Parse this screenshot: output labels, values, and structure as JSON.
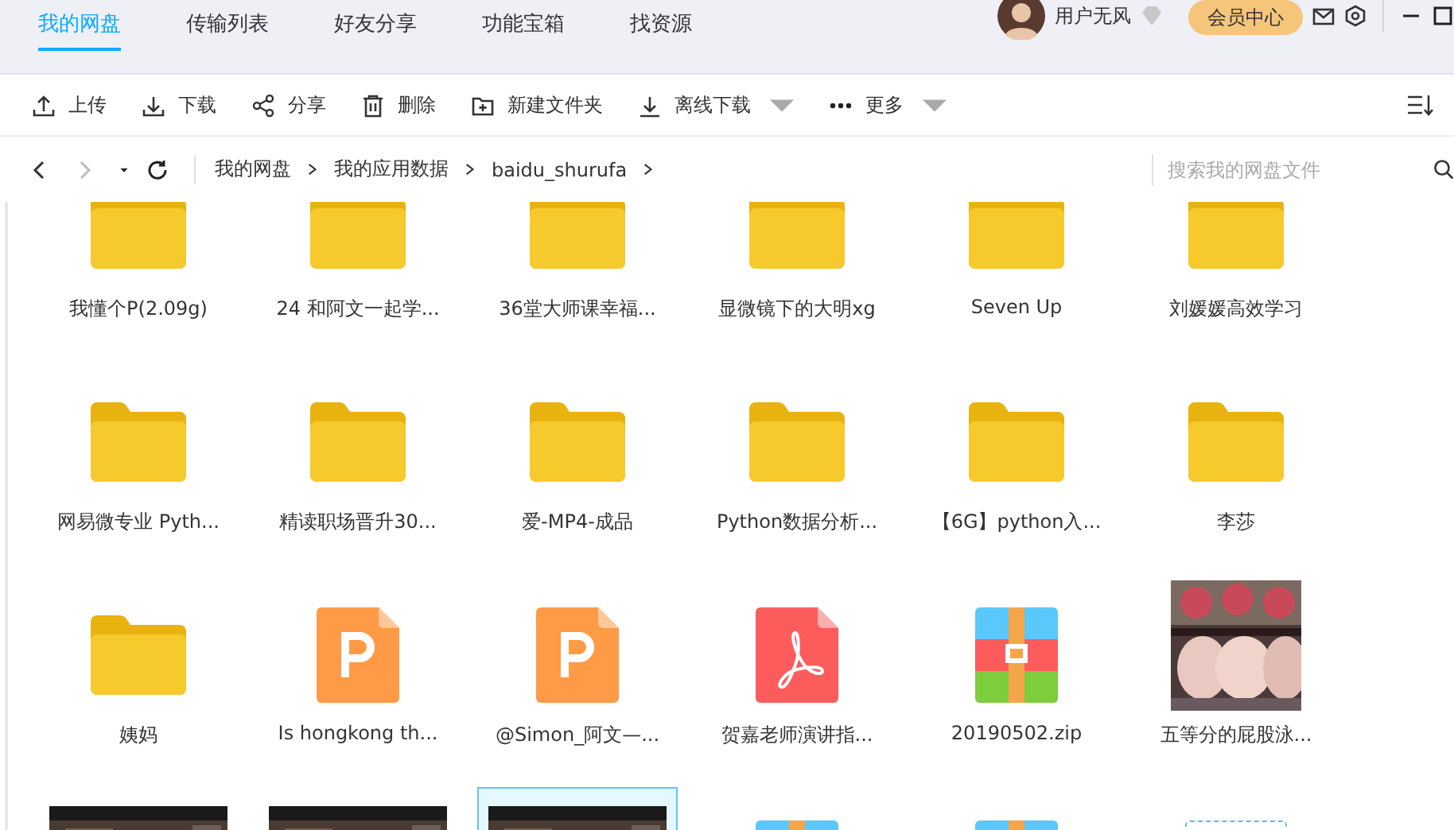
{
  "tabs": [
    {
      "label": "我的网盘",
      "selected": true
    },
    {
      "label": "传输列表",
      "selected": false
    },
    {
      "label": "好友分享",
      "selected": false
    },
    {
      "label": "功能宝箱",
      "selected": false
    },
    {
      "label": "找资源",
      "selected": false
    }
  ],
  "user": {
    "name": "用户无风",
    "vip_button": "会员中心"
  },
  "toolbar": [
    {
      "kind": "upload",
      "label": "上传",
      "dropdown": false
    },
    {
      "kind": "download",
      "label": "下载",
      "dropdown": false
    },
    {
      "kind": "share",
      "label": "分享",
      "dropdown": false
    },
    {
      "kind": "delete",
      "label": "删除",
      "dropdown": false
    },
    {
      "kind": "newfolder",
      "label": "新建文件夹",
      "dropdown": false
    },
    {
      "kind": "offline",
      "label": "离线下载",
      "dropdown": true
    },
    {
      "kind": "more",
      "label": "更多",
      "dropdown": true
    }
  ],
  "breadcrumb": [
    "我的网盘",
    "我的应用数据",
    "baidu_shurufa"
  ],
  "search": {
    "placeholder": "搜索我的网盘文件"
  },
  "files": [
    {
      "kind": "folder",
      "name": "我懂个P(2.09g)",
      "selected": false
    },
    {
      "kind": "folder",
      "name": "24 和阿文一起学...",
      "selected": false
    },
    {
      "kind": "folder",
      "name": "36堂大师课幸福...",
      "selected": false
    },
    {
      "kind": "folder",
      "name": "显微镜下的大明xg",
      "selected": false
    },
    {
      "kind": "folder",
      "name": "Seven Up",
      "selected": false
    },
    {
      "kind": "folder",
      "name": "刘媛媛高效学习",
      "selected": false
    },
    {
      "kind": "folder",
      "name": "网易微专业 Pyth...",
      "selected": false
    },
    {
      "kind": "folder",
      "name": "精读职场晋升30...",
      "selected": false
    },
    {
      "kind": "folder",
      "name": "爱-MP4-成品",
      "selected": false
    },
    {
      "kind": "folder",
      "name": "Python数据分析...",
      "selected": false
    },
    {
      "kind": "folder",
      "name": "【6G】python入...",
      "selected": false
    },
    {
      "kind": "folder",
      "name": "李莎",
      "selected": false
    },
    {
      "kind": "folder",
      "name": "姨妈",
      "selected": false
    },
    {
      "kind": "ppt",
      "name": "Is hongkong th...",
      "selected": false
    },
    {
      "kind": "ppt",
      "name": "@Simon_阿文—...",
      "selected": false
    },
    {
      "kind": "pdf",
      "name": "贺嘉老师演讲指...",
      "selected": false
    },
    {
      "kind": "zip",
      "name": "20190502.zip",
      "selected": false
    },
    {
      "kind": "picture",
      "name": "五等分的屁股泳...",
      "selected": false
    },
    {
      "kind": "video",
      "selected": false
    },
    {
      "kind": "video",
      "selected": false
    },
    {
      "kind": "video",
      "selected": true
    },
    {
      "kind": "zip",
      "selected": false
    },
    {
      "kind": "zip",
      "selected": false
    },
    {
      "kind": "slot",
      "selected": false
    }
  ]
}
